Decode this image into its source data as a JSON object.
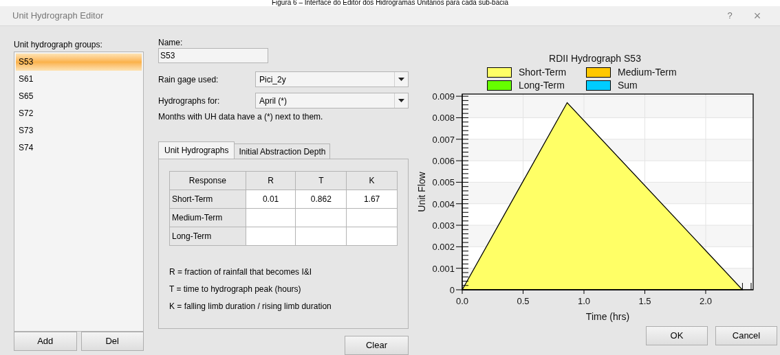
{
  "caption": "Figura 6 – Interface do Editor dos Hidrogramas Unitários para cada sub-bacia",
  "window": {
    "title": "Unit Hydrograph Editor",
    "help": "?",
    "close": "×"
  },
  "groups": {
    "label": "Unit hydrograph groups:",
    "items": [
      {
        "label": "S53",
        "selected": true
      },
      {
        "label": "S61",
        "selected": false
      },
      {
        "label": "S65",
        "selected": false
      },
      {
        "label": "S72",
        "selected": false
      },
      {
        "label": "S73",
        "selected": false
      },
      {
        "label": "S74",
        "selected": false
      }
    ],
    "buttons": [
      "Add",
      "Del"
    ]
  },
  "name": {
    "label": "Name:",
    "value": "S53"
  },
  "rain_gage": {
    "label": "Rain gage used:",
    "value": "Pici_2y"
  },
  "hydrographs_for": {
    "label": "Hydrographs for:",
    "value": "April (*)"
  },
  "note": "Months with UH data have a (*) next to them.",
  "tabs": [
    {
      "label": "Unit Hydrographs",
      "selected": true
    },
    {
      "label": "Initial Abstraction Depth",
      "selected": false
    }
  ],
  "table": {
    "columns": [
      "Response",
      "R",
      "T",
      "K"
    ],
    "rows": [
      [
        "Short-Term",
        "0.01",
        "0.862",
        "1.67"
      ],
      [
        "Medium-Term",
        "",
        "",
        ""
      ],
      [
        "Long-Term",
        "",
        "",
        ""
      ]
    ]
  },
  "legend_notes": [
    "R = fraction of rainfall that becomes I&I",
    "T = time to hydrograph peak (hours)",
    "K = falling limb duration / rising limb duration"
  ],
  "clear_button": "Clear",
  "chart": {
    "chart_data": {
      "type": "area",
      "title": "RDII Hydrograph S53",
      "xlabel": "Time (hrs)",
      "ylabel": "Unit Flow",
      "x": [
        0,
        0.862,
        2.302
      ],
      "series": [
        {
          "name": "Short-Term",
          "color": "#ffff66",
          "values": [
            0,
            0.0087,
            0
          ]
        },
        {
          "name": "Medium-Term",
          "color": "#ffc800",
          "values": [
            null,
            null,
            null
          ]
        },
        {
          "name": "Long-Term",
          "color": "#66ff00",
          "values": [
            null,
            null,
            null
          ]
        },
        {
          "name": "Sum",
          "color": "#00ccff",
          "values": [
            null,
            null,
            null
          ]
        }
      ],
      "grid": true,
      "xlim": [
        0,
        2.39
      ],
      "ylim": [
        0,
        0.0091
      ],
      "xticks": [
        {
          "value": 0,
          "label": "0.0"
        },
        {
          "value": 0.5,
          "label": "0.5"
        },
        {
          "value": 1,
          "label": "1.0"
        },
        {
          "value": 1.5,
          "label": "1.5"
        },
        {
          "value": 2,
          "label": "2.0"
        }
      ],
      "yticks": [
        {
          "value": 0,
          "label": "0"
        },
        {
          "value": 0.001,
          "label": "0.001"
        },
        {
          "value": 0.002,
          "label": "0.002"
        },
        {
          "value": 0.003,
          "label": "0.003"
        },
        {
          "value": 0.004,
          "label": "0.004"
        },
        {
          "value": 0.005,
          "label": "0.005"
        },
        {
          "value": 0.006,
          "label": "0.006"
        },
        {
          "value": 0.007,
          "label": "0.007"
        },
        {
          "value": 0.008,
          "label": "0.008"
        },
        {
          "value": 0.009,
          "label": "0.009"
        }
      ]
    }
  },
  "dialog_buttons": [
    "OK",
    "Cancel"
  ]
}
